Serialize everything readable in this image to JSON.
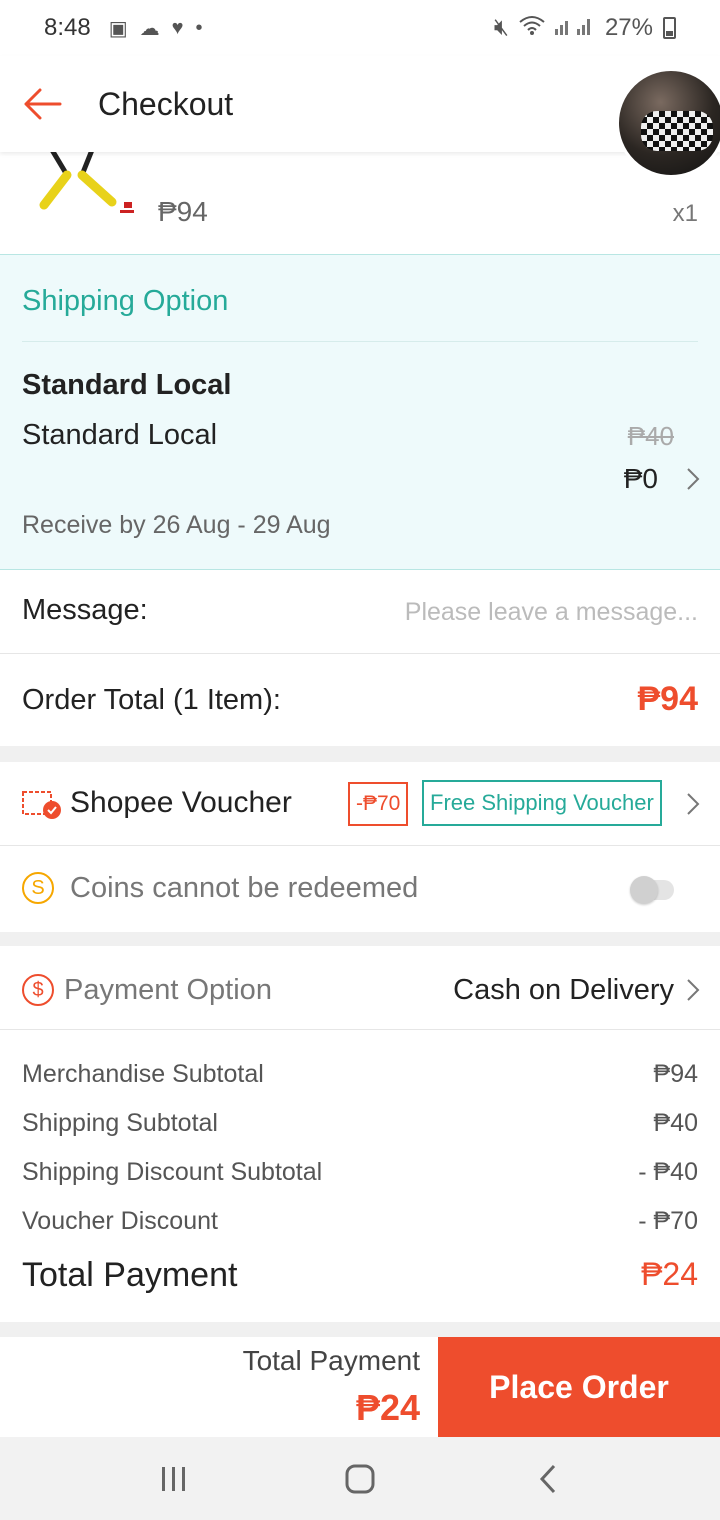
{
  "status_bar": {
    "time": "8:48",
    "battery": "27%",
    "icons": [
      "image-icon",
      "cloud-icon",
      "lazada-icon",
      "dot-icon",
      "mute-icon",
      "wifi-icon",
      "signal-icon"
    ]
  },
  "app_bar": {
    "title": "Checkout",
    "back_icon": "arrow-left-icon"
  },
  "product": {
    "price": "₱94",
    "quantity": "x1"
  },
  "shipping": {
    "heading": "Shipping Option",
    "method_bold": "Standard Local",
    "method": "Standard Local",
    "original_fee": "₱40",
    "fee": "₱0",
    "receive_by": "Receive by 26 Aug - 29 Aug"
  },
  "message": {
    "label": "Message:",
    "placeholder": "Please leave a message...",
    "value": ""
  },
  "order_total": {
    "label": "Order Total (1 Item):",
    "value": "₱94"
  },
  "voucher": {
    "label": "Shopee Voucher",
    "discount_tag": "-₱70",
    "shipping_tag": "Free Shipping Voucher"
  },
  "coins": {
    "label": "Coins cannot be redeemed",
    "enabled": false
  },
  "payment_option": {
    "label": "Payment Option",
    "value": "Cash on Delivery"
  },
  "summary": {
    "rows": [
      {
        "label": "Merchandise Subtotal",
        "value": "₱94"
      },
      {
        "label": "Shipping Subtotal",
        "value": "₱40"
      },
      {
        "label": "Shipping Discount Subtotal",
        "value": "- ₱40"
      },
      {
        "label": "Voucher Discount",
        "value": "- ₱70"
      }
    ],
    "total_label": "Total Payment",
    "total_value": "₱24"
  },
  "bottom_bar": {
    "total_label": "Total Payment",
    "total_value": "₱24",
    "button": "Place Order"
  },
  "colors": {
    "accent": "#ee4d2d",
    "teal": "#26aa99",
    "shipping_bg": "#eefafb"
  }
}
